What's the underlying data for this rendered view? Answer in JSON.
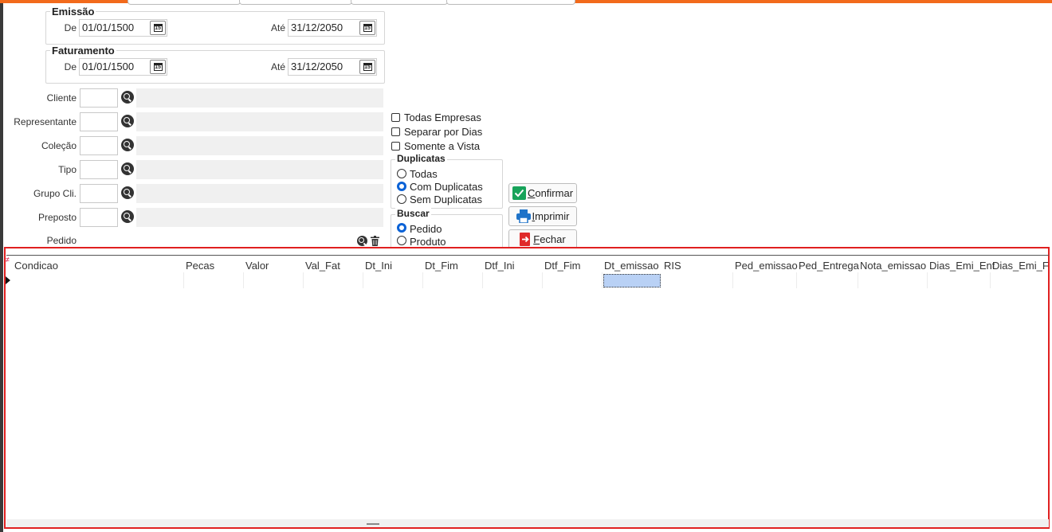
{
  "emissao": {
    "title": "Emissão",
    "de_label": "De",
    "de_value": "01/01/1500",
    "ate_label": "Até",
    "ate_value": "31/12/2050"
  },
  "faturamento": {
    "title": "Faturamento",
    "de_label": "De",
    "de_value": "01/01/1500",
    "ate_label": "Até",
    "ate_value": "31/12/2050"
  },
  "calendar_icon_text": "15",
  "filters": [
    {
      "label": "Cliente"
    },
    {
      "label": "Representante"
    },
    {
      "label": "Coleção"
    },
    {
      "label": "Tipo"
    },
    {
      "label": "Grupo Cli."
    },
    {
      "label": "Preposto"
    }
  ],
  "pedido": {
    "label": "Pedido",
    "value": ""
  },
  "options": {
    "todas_empresas": "Todas Empresas",
    "separar_dias": "Separar por Dias",
    "somente_vista": "Somente a Vista"
  },
  "duplicatas": {
    "title": "Duplicatas",
    "opt1": "Todas",
    "opt2": "Com Duplicatas",
    "opt3": "Sem Duplicatas",
    "selected": "Com Duplicatas"
  },
  "buscar": {
    "title": "Buscar",
    "opt1": "Pedido",
    "opt2": "Produto",
    "selected": "Pedido"
  },
  "buttons": {
    "confirmar_first": "C",
    "confirmar_rest": "onfirmar",
    "imprimir_first": "I",
    "imprimir_rest": "mprimir",
    "fechar_first": "F",
    "fechar_rest": "echar"
  },
  "grid": {
    "columns": [
      "Condicao",
      "Pecas",
      "Valor",
      "Val_Fat",
      "Dt_Ini",
      "Dt_Fim",
      "Dtf_Ini",
      "Dtf_Fim",
      "Dt_emissao",
      "RIS",
      "Ped_emissao",
      "Ped_Entrega",
      "Nota_emissao",
      "Dias_Emi_Ent",
      "Dias_Emi_Fat"
    ],
    "corner_mark": "≠"
  },
  "colors": {
    "accent_orange": "#f26a1b",
    "grid_highlight": "#e02020",
    "radio_selected": "#0b62d6",
    "selected_cell": "#b9d1f5"
  },
  "icons": [
    "calendar-icon",
    "search-icon",
    "trash-icon",
    "check-icon",
    "printer-icon",
    "exit-icon"
  ]
}
